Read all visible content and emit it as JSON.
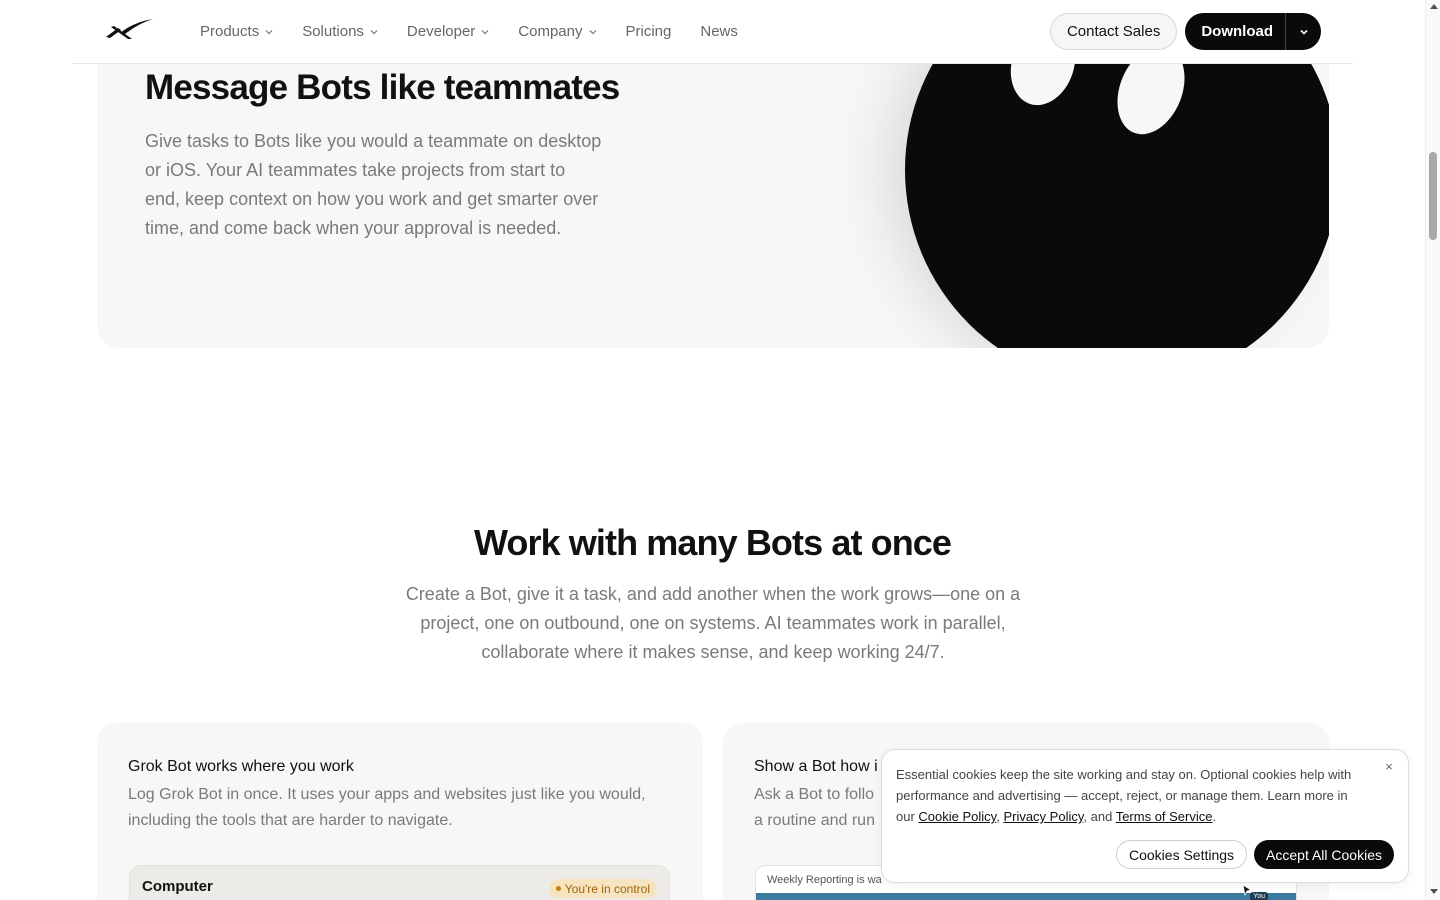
{
  "nav": {
    "items": [
      {
        "label": "Products",
        "has_menu": true
      },
      {
        "label": "Solutions",
        "has_menu": true
      },
      {
        "label": "Developer",
        "has_menu": true
      },
      {
        "label": "Company",
        "has_menu": true
      },
      {
        "label": "Pricing",
        "has_menu": false
      },
      {
        "label": "News",
        "has_menu": false
      }
    ],
    "contact_label": "Contact Sales",
    "download_label": "Download"
  },
  "hero": {
    "title": "Message Bots like teammates",
    "text": "Give tasks to Bots like you would a teammate on desktop or iOS. Your AI teammates take projects from start to end, keep context on how you work and get smarter over time, and come back when your approval is needed."
  },
  "section": {
    "title": "Work with many Bots at once",
    "text": "Create a Bot, give it a task, and add another when the work grows—one on a project, one on outbound, one on systems. AI teammates work in parallel, collaborate where it makes sense, and keep working 24/7."
  },
  "cards": {
    "left": {
      "title": "Grok Bot works where you work",
      "text": "Log Grok Bot in once. It uses your apps and websites just like you would, including the tools that are harder to navigate.",
      "box_label": "Computer",
      "badge": "You're in control"
    },
    "right": {
      "title": "Show a Bot how i",
      "text_line1": "Ask a Bot to follo",
      "text_line2": "a routine and run",
      "box_label": "Weekly Reporting is wa",
      "you_tag": "You"
    }
  },
  "cookie": {
    "text_main": "Essential cookies keep the site working and stay on. Optional cookies help with performance and advertising — accept, reject, or manage them. Learn more in our ",
    "cookie_policy": "Cookie Policy",
    "sep1": ", ",
    "privacy_policy": "Privacy Policy",
    "sep2": ", and ",
    "terms": "Terms of Service",
    "end": ".",
    "settings_label": "Cookies Settings",
    "accept_label": "Accept All Cookies",
    "close_label": "×"
  },
  "colors": {
    "accent_dark": "#0a0a0a",
    "card_bg": "#f8f7f5",
    "muted_text": "#7a7a7a",
    "badge_bg": "#f6e3bf",
    "badge_text": "#a0640d"
  }
}
